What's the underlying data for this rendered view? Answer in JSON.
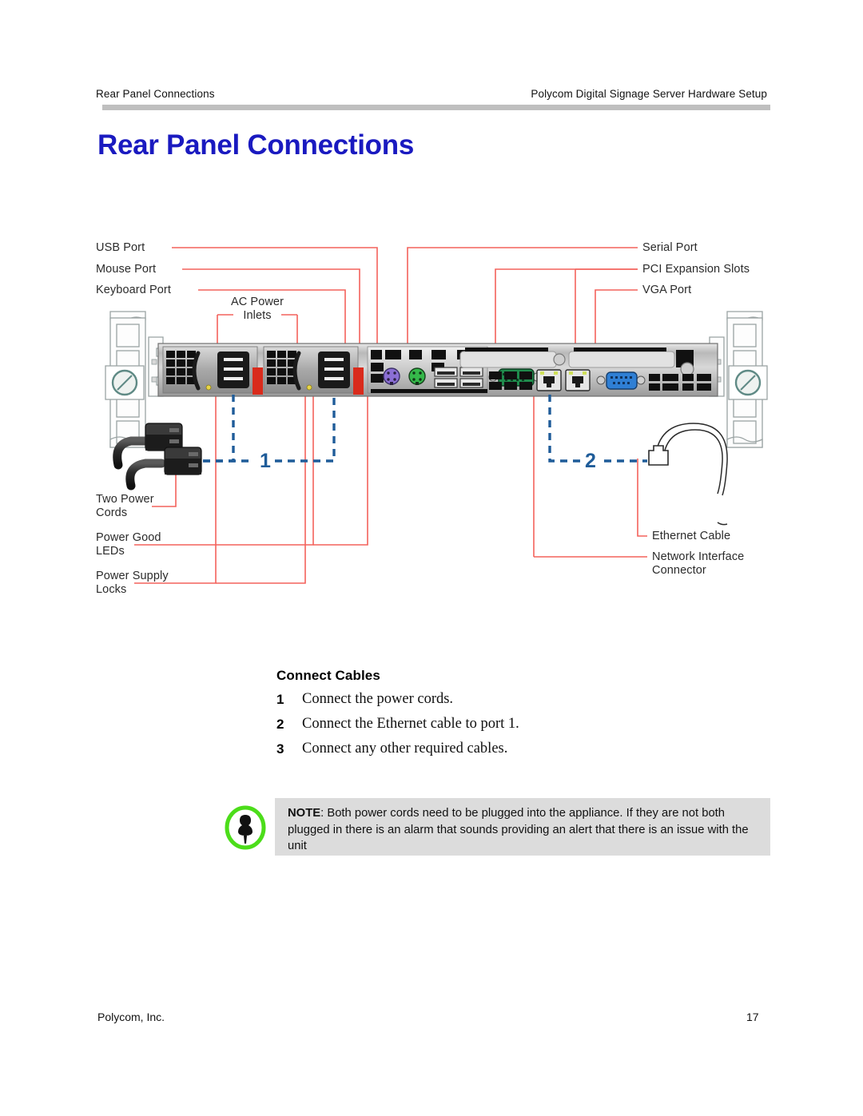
{
  "header": {
    "left": "Rear Panel Connections",
    "right": "Polycom Digital Signage Server Hardware Setup"
  },
  "title": "Rear Panel Connections",
  "figure": {
    "labels": {
      "usb_port": "USB Port",
      "mouse_port": "Mouse Port",
      "keyboard_port": "Keyboard Port",
      "ac_power_inlets_line1": "AC Power",
      "ac_power_inlets_line2": "Inlets",
      "serial_port": "Serial Port",
      "pci_expansion_slots": "PCI Expansion Slots",
      "vga_port": "VGA Port",
      "two_power_cords_line1": "Two Power",
      "two_power_cords_line2": "Cords",
      "power_good_leds_line1": "Power Good",
      "power_good_leds_line2": "LEDs",
      "power_supply_locks_line1": "Power Supply",
      "power_supply_locks_line2": "Locks",
      "ethernet_cable": "Ethernet Cable",
      "network_interface_connector_line1": "Network Interface",
      "network_interface_connector_line2": "Connector"
    },
    "callout_numbers": {
      "one": "1",
      "two": "2"
    },
    "colors": {
      "leader_line": "#f4625c",
      "callout_blue": "#1f5c99",
      "title_blue": "#1a1ac0",
      "rule_gray": "#bfbfbf",
      "ps2_keyboard": "#8b6fd4",
      "ps2_mouse": "#35b84a",
      "serial_green": "#1f8b4c",
      "vga_blue": "#2f7fd4",
      "lock_red": "#d92b1c",
      "led_yellow": "#e8d64a"
    }
  },
  "procedure": {
    "heading": "Connect Cables",
    "steps": [
      {
        "number": "1",
        "text": "Connect the power cords."
      },
      {
        "number": "2",
        "text": "Connect the Ethernet cable to port 1."
      },
      {
        "number": "3",
        "text": "Connect any other required cables."
      }
    ]
  },
  "note": {
    "label": "NOTE",
    "text": ": Both power cords need to be plugged into the appliance.  If they are not both plugged in there is an alarm that sounds providing an alert that there is an issue with the unit",
    "icon_color": "#4cdd1a"
  },
  "footer": {
    "left": "Polycom, Inc.",
    "page_number": "17"
  }
}
